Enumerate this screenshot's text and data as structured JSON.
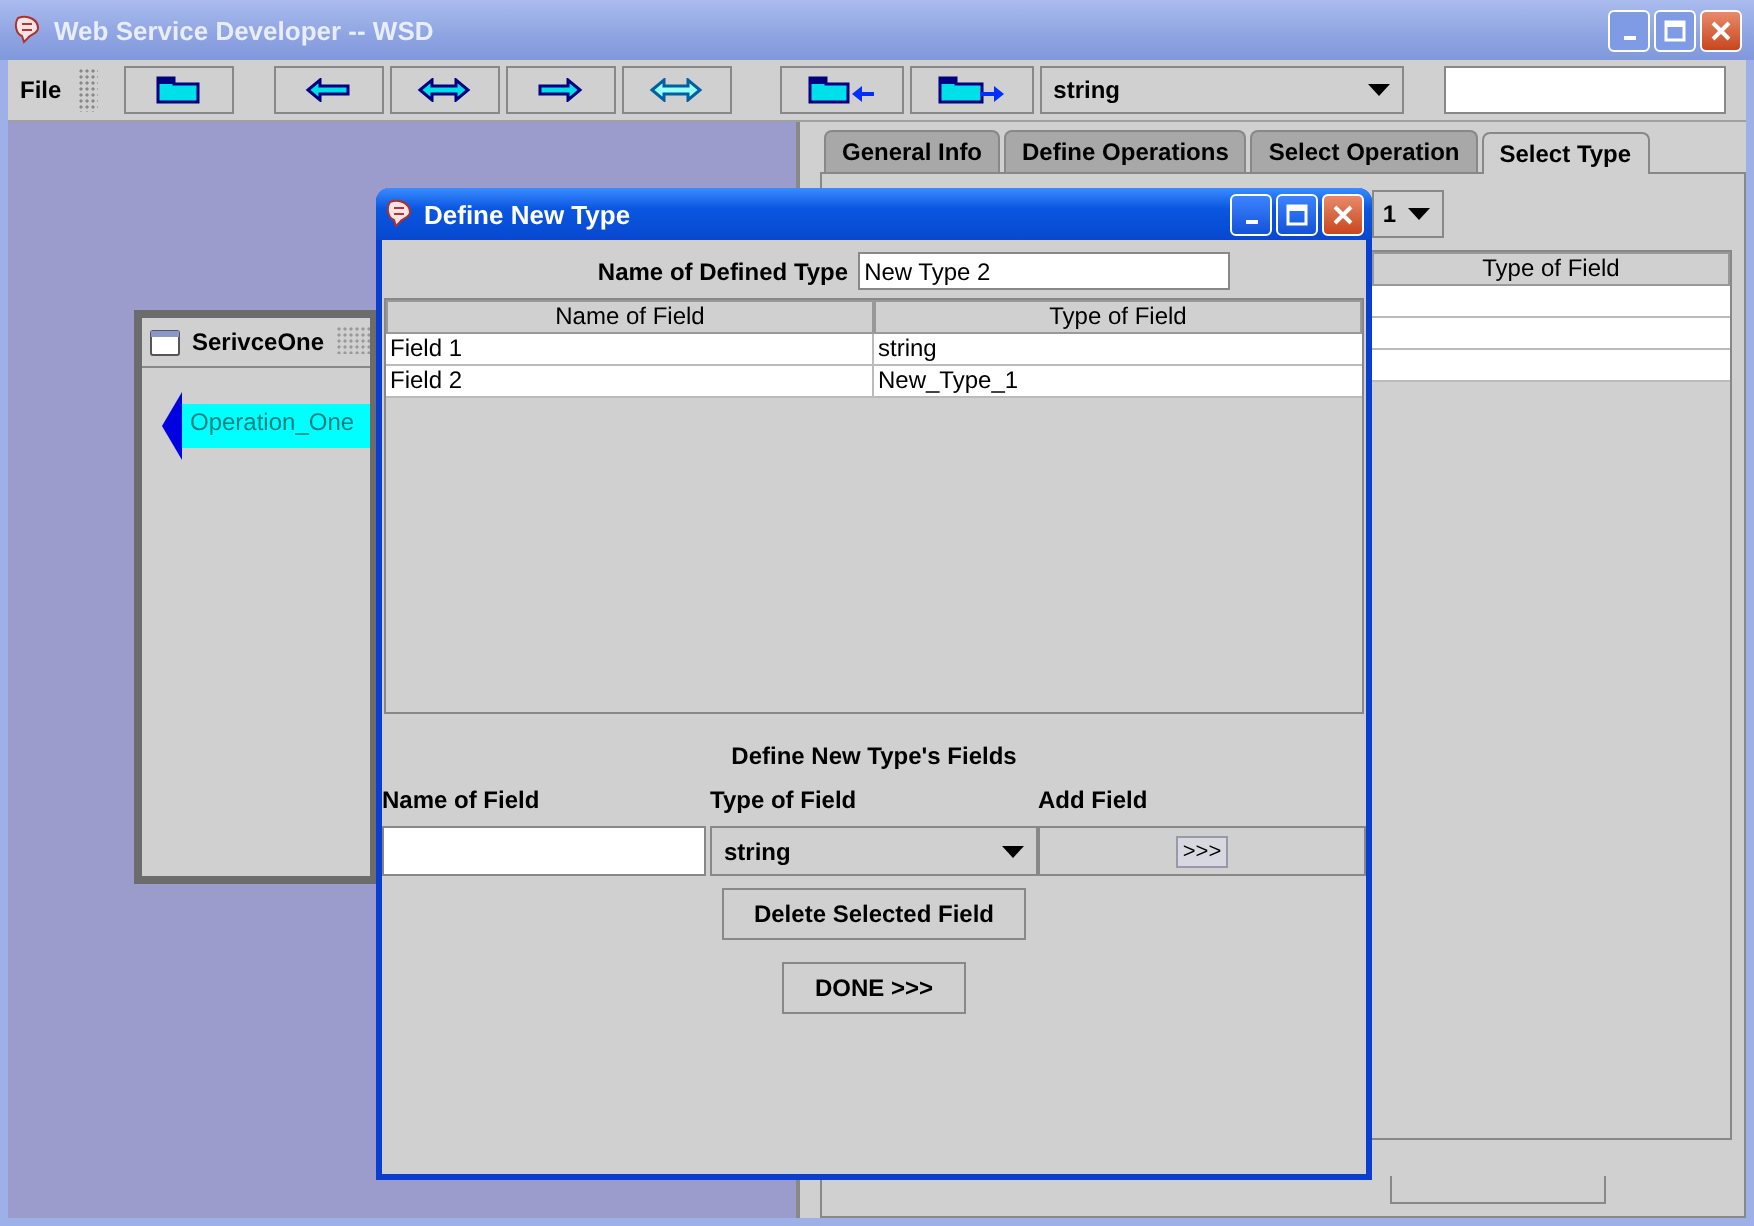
{
  "window": {
    "title": "Web Service Developer -- WSD"
  },
  "menu": [
    "File"
  ],
  "toolbar": [
    {
      "kind": "folder"
    },
    {
      "kind": "left"
    },
    {
      "kind": "both"
    },
    {
      "kind": "right"
    },
    {
      "kind": "both-light"
    },
    {
      "kind": "folder-in"
    },
    {
      "kind": "folder-out"
    }
  ],
  "type_combo": {
    "value": "string"
  },
  "canvas": {
    "service": {
      "title": "SerivceOne",
      "operations": [
        "Operation_One"
      ]
    }
  },
  "tabs": [
    {
      "label": "General Info",
      "selected": false
    },
    {
      "label": "Define Operations",
      "selected": false
    },
    {
      "label": "Select Operation",
      "selected": false
    },
    {
      "label": "Select Type",
      "selected": true
    }
  ],
  "select_type": {
    "combo_value": "1",
    "columns": [
      "Type of Field"
    ]
  },
  "dialog": {
    "title": "Define New Type",
    "name_label": "Name of Defined Type",
    "name_value": "New Type 2",
    "columns": [
      "Name of Field",
      "Type of Field"
    ],
    "rows": [
      {
        "name": "Field 1",
        "type": "string"
      },
      {
        "name": "Field 2",
        "type": "New_Type_1"
      }
    ],
    "section_title": "Define New Type's Fields",
    "field_labels": [
      "Name of Field",
      "Type of Field",
      "Add Field"
    ],
    "type_value": "string",
    "add_button": ">>>",
    "delete_button": "Delete Selected Field",
    "done_button": "DONE >>>"
  }
}
